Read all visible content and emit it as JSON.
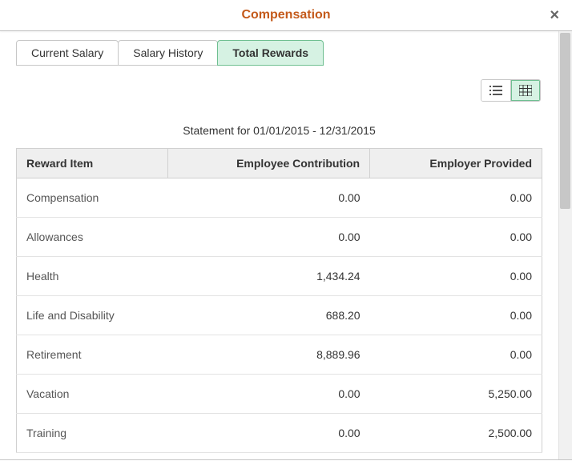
{
  "modal": {
    "title": "Compensation"
  },
  "tabs": [
    {
      "label": "Current Salary",
      "active": false
    },
    {
      "label": "Salary History",
      "active": false
    },
    {
      "label": "Total Rewards",
      "active": true
    }
  ],
  "view": {
    "active": "grid"
  },
  "statement_label": "Statement for 01/01/2015 - 12/31/2015",
  "columns": {
    "item": "Reward Item",
    "employee": "Employee Contribution",
    "employer": "Employer Provided"
  },
  "rows": [
    {
      "item": "Compensation",
      "employee": "0.00",
      "employer": "0.00"
    },
    {
      "item": "Allowances",
      "employee": "0.00",
      "employer": "0.00"
    },
    {
      "item": "Health",
      "employee": "1,434.24",
      "employer": "0.00"
    },
    {
      "item": "Life and Disability",
      "employee": "688.20",
      "employer": "0.00"
    },
    {
      "item": "Retirement",
      "employee": "8,889.96",
      "employer": "0.00"
    },
    {
      "item": "Vacation",
      "employee": "0.00",
      "employer": "5,250.00"
    },
    {
      "item": "Training",
      "employee": "0.00",
      "employer": "2,500.00"
    }
  ]
}
